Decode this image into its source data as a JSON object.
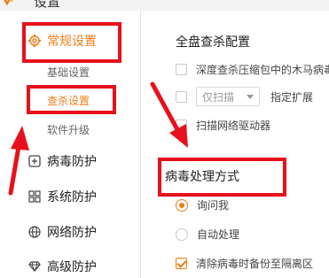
{
  "window": {
    "title": "设置"
  },
  "sidebar": {
    "general": {
      "label": "常规设置",
      "icon": "gear-icon"
    },
    "general_sub": [
      {
        "label": "基础设置"
      },
      {
        "label": "查杀设置"
      },
      {
        "label": "软件升级"
      }
    ],
    "items": [
      {
        "label": "病毒防护",
        "icon": "plus-box-icon"
      },
      {
        "label": "系统防护",
        "icon": "grid-icon"
      },
      {
        "label": "网络防护",
        "icon": "globe-icon"
      },
      {
        "label": "高级防护",
        "icon": "diamond-icon"
      }
    ]
  },
  "main": {
    "scan_section": {
      "title": "全盘查杀配置",
      "deep_scan_label": "深度查杀压缩包中的木马病毒",
      "scan_mode_value": "仅扫描",
      "extension_label": "指定扩展",
      "network_drive_label": "扫描网络驱动器"
    },
    "virus_section": {
      "title": "病毒处理方式",
      "ask_label": "询问我",
      "auto_label": "自动处理",
      "backup_label": "清除病毒时备份至隔离区"
    }
  },
  "colors": {
    "accent": "#ee7d1b",
    "annotation": "#e8101a"
  }
}
